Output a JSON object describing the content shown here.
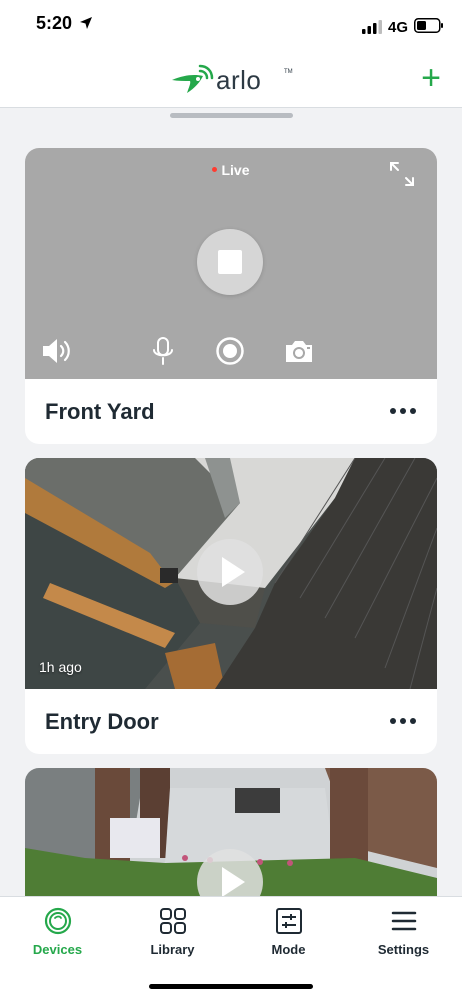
{
  "status_bar": {
    "time": "5:20",
    "network": "4G"
  },
  "header": {
    "logo_text": "arlo",
    "add_label": "+"
  },
  "cameras": [
    {
      "name": "Front Yard",
      "live_label": "Live",
      "icons": [
        "fullscreen-icon",
        "stop-icon",
        "speaker-icon",
        "mic-icon",
        "record-icon",
        "snapshot-icon"
      ]
    },
    {
      "name": "Entry Door",
      "time_ago": "1h ago"
    },
    {
      "name": ""
    }
  ],
  "tabs": [
    {
      "label": "Devices",
      "icon": "devices-icon",
      "active": true
    },
    {
      "label": "Library",
      "icon": "library-icon",
      "active": false
    },
    {
      "label": "Mode",
      "icon": "mode-icon",
      "active": false
    },
    {
      "label": "Settings",
      "icon": "menu-icon",
      "active": false
    }
  ],
  "colors": {
    "accent": "#25a84b",
    "live_dot": "#ff3b30",
    "text": "#1f2a33",
    "background": "#f1f2f4"
  }
}
